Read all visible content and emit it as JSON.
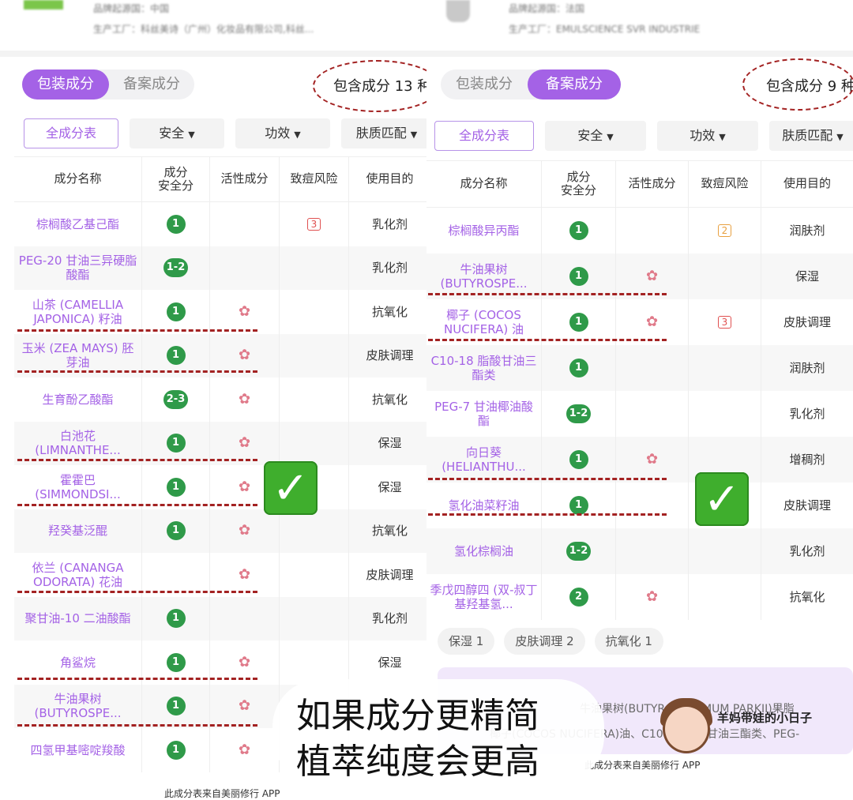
{
  "left": {
    "top": {
      "origin_line": "品牌起源国：中国",
      "factory_line": "生产工厂：科丝美诗（广州）化妆品有限公司,科丝..."
    },
    "tabs": [
      {
        "label": "包装成分",
        "active": true
      },
      {
        "label": "备案成分",
        "active": false
      }
    ],
    "count_text": "包含成分 13 种",
    "filters": {
      "all": "全成分表",
      "safety": "安全",
      "efficacy": "功效",
      "skin": "肤质匹配"
    },
    "headers": {
      "name": "成分名称",
      "safety": "成分\n安全分",
      "active": "活性成分",
      "acne": "致痘风险",
      "purpose": "使用目的"
    },
    "rows": [
      {
        "name": "棕榈酸乙基己酯",
        "score": "1",
        "active": false,
        "acne": "3",
        "purpose": "乳化剂"
      },
      {
        "name": "PEG-20 甘油三异硬脂酸酯",
        "score": "1-2",
        "active": false,
        "acne": "",
        "purpose": "乳化剂"
      },
      {
        "name": "山茶 (CAMELLIA JAPONICA) 籽油",
        "score": "1",
        "active": true,
        "acne": "",
        "purpose": "抗氧化"
      },
      {
        "name": "玉米 (ZEA MAYS) 胚芽油",
        "score": "1",
        "active": true,
        "acne": "",
        "purpose": "皮肤调理"
      },
      {
        "name": "生育酚乙酸酯",
        "score": "2-3",
        "active": true,
        "acne": "",
        "purpose": "抗氧化"
      },
      {
        "name": "白池花 (LIMNANTHE...",
        "score": "1",
        "active": true,
        "acne": "",
        "purpose": "保湿"
      },
      {
        "name": "霍霍巴 (SIMMONDSI...",
        "score": "1",
        "active": true,
        "acne": "",
        "purpose": "保湿"
      },
      {
        "name": "羟癸基泛醌",
        "score": "1",
        "active": true,
        "acne": "",
        "purpose": "抗氧化"
      },
      {
        "name": "依兰 (CANANGA ODORATA) 花油",
        "score": "",
        "active": true,
        "acne": "",
        "purpose": "皮肤调理"
      },
      {
        "name": "聚甘油-10 二油酸酯",
        "score": "1",
        "active": false,
        "acne": "",
        "purpose": "乳化剂"
      },
      {
        "name": "角鲨烷",
        "score": "1",
        "active": true,
        "acne": "",
        "purpose": "保湿"
      },
      {
        "name": "牛油果树 (BUTYROSPE...",
        "score": "1",
        "active": true,
        "acne": "",
        "purpose": ""
      },
      {
        "name": "四氢甲基嘧啶羧酸",
        "score": "1",
        "active": true,
        "acne": "",
        "purpose": ""
      }
    ],
    "footer": "此成分表来自美丽修行 APP"
  },
  "right": {
    "top": {
      "origin_line": "品牌起源国：法国",
      "factory_line": "生产工厂：EMULSCIENCE SVR INDUSTRIE"
    },
    "tabs": [
      {
        "label": "包装成分",
        "active": false
      },
      {
        "label": "备案成分",
        "active": true
      }
    ],
    "count_text": "包含成分 9 种",
    "filters": {
      "all": "全成分表",
      "safety": "安全",
      "efficacy": "功效",
      "skin": "肤质匹配"
    },
    "headers": {
      "name": "成分名称",
      "safety": "成分\n安全分",
      "active": "活性成分",
      "acne": "致痘风险",
      "purpose": "使用目的"
    },
    "rows": [
      {
        "name": "棕榈酸异丙酯",
        "score": "1",
        "active": false,
        "acne": "2",
        "purpose": "润肤剂"
      },
      {
        "name": "牛油果树 (BUTYROSPE...",
        "score": "1",
        "active": true,
        "acne": "",
        "purpose": "保湿"
      },
      {
        "name": "椰子 (COCOS NUCIFERA) 油",
        "score": "1",
        "active": true,
        "acne": "3",
        "purpose": "皮肤调理"
      },
      {
        "name": "C10-18 脂酸甘油三酯类",
        "score": "1",
        "active": false,
        "acne": "",
        "purpose": "润肤剂"
      },
      {
        "name": "PEG-7 甘油椰油酸酯",
        "score": "1-2",
        "active": false,
        "acne": "",
        "purpose": "乳化剂"
      },
      {
        "name": "向日葵 (HELIANTHU...",
        "score": "1",
        "active": true,
        "acne": "",
        "purpose": "增稠剂"
      },
      {
        "name": "氢化油菜籽油",
        "score": "1",
        "active": false,
        "acne": "",
        "purpose": "皮肤调理"
      },
      {
        "name": "氢化棕榈油",
        "score": "1-2",
        "active": false,
        "acne": "",
        "purpose": "乳化剂"
      },
      {
        "name": "季戊四醇四 (双-叔丁基羟基氢...",
        "score": "2",
        "active": true,
        "acne": "",
        "purpose": "抗氧化"
      }
    ],
    "pills": [
      "保湿 1",
      "皮肤调理 2",
      "抗氧化 1"
    ],
    "box_line1": "牛油果树(BUTYROSPERMUM PARKII)果脂",
    "box_line2": "椰子(COCOS NUCIFERA)油、C10-18 脂酸甘油三酯类、PEG-",
    "footer": "此成分表来自美丽修行 APP"
  },
  "caption": {
    "line1": "如果成分更精简",
    "line2": "植萃纯度会更高"
  },
  "sticker": {
    "text": "羊妈带娃的小日子"
  },
  "colors": {
    "accent": "#a462e6",
    "score_green": "#2f9a49",
    "annotation_red": "#a32222",
    "check_green": "#3fae2d"
  },
  "icons": {
    "active": "flower-icon",
    "acne": "warning-triangle-icon",
    "safe": "check-mark-icon"
  }
}
